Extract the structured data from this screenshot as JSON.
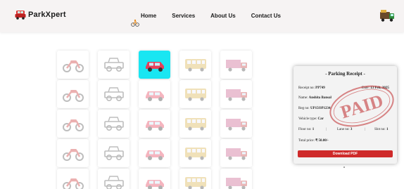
{
  "brand": {
    "name": "ParkXpert",
    "icon": "car-logo-icon"
  },
  "nav": [
    {
      "label": "Home"
    },
    {
      "label": "Services"
    },
    {
      "label": "About Us"
    },
    {
      "label": "Contact Us"
    }
  ],
  "decor": {
    "left_icon": "bicycle-icon",
    "right_icon": "truck-icon"
  },
  "grid": {
    "columns": [
      "motorbike",
      "jeep",
      "car",
      "bus",
      "truck"
    ],
    "rows": 5,
    "selected": {
      "row": 0,
      "column": "car"
    }
  },
  "receipt": {
    "title": "- Parking Receipt -",
    "receipt_no_label": "Receipt no:",
    "receipt_no": "PP749",
    "date_label": "Date:",
    "date": "13 Feb, 2025",
    "name_label": "Name:",
    "name": "Anshita Bansal",
    "reg_label": "Reg no:",
    "reg": "UP15OP1234",
    "vehicle_label": "Vehicle type:",
    "vehicle": "Car",
    "floor_label": "Floor no:",
    "floor": "1",
    "lane_label": "Lane no:",
    "lane": "3",
    "slot_label": "Slot no:",
    "slot": "1",
    "price_label": "Total price:",
    "price": "₹ 50.00/-",
    "stamp": "PAID",
    "download_label": "Download PDF"
  },
  "colors": {
    "selected": "#19e6f2",
    "stamp": "#c0292b",
    "button": "#cf2a2a"
  }
}
